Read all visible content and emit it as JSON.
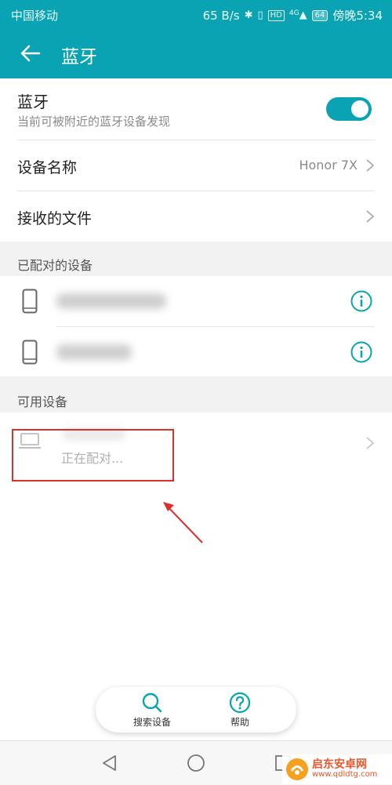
{
  "status_bar": {
    "carrier": "中国移动",
    "speed": "65 B/s",
    "hd_badge": "HD",
    "signal_label": "4G",
    "battery": "64",
    "time": "傍晚5:34"
  },
  "app_bar": {
    "title": "蓝牙"
  },
  "bluetooth": {
    "title": "蓝牙",
    "subtitle": "当前可被附近的蓝牙设备发现",
    "enabled": true
  },
  "device_name_row": {
    "label": "设备名称",
    "value": "Honor 7X"
  },
  "received_files_row": {
    "label": "接收的文件"
  },
  "paired_section": {
    "header": "已配对的设备"
  },
  "available_section": {
    "header": "可用设备",
    "pairing_status": "正在配对..."
  },
  "actions": {
    "search_label": "搜索设备",
    "help_label": "帮助"
  },
  "watermark": {
    "brand": "启东安卓网",
    "url": "www.qdldtg.com"
  },
  "colors": {
    "accent": "#0aa3b3",
    "highlight": "#d9322d"
  }
}
